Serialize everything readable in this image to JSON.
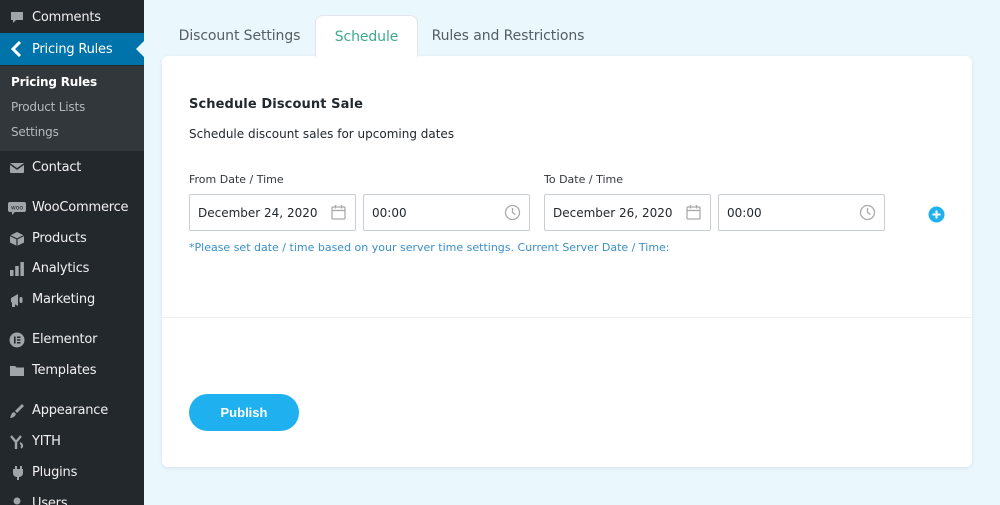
{
  "sidebar": {
    "items": [
      {
        "label": "Comments",
        "icon": "comments-icon"
      },
      {
        "label": "Pricing Rules",
        "icon": "chevron-left-icon",
        "active": true
      },
      {
        "label": "Contact",
        "icon": "envelope-icon"
      },
      {
        "label": "WooCommerce",
        "icon": "woocommerce-icon"
      },
      {
        "label": "Products",
        "icon": "box-icon"
      },
      {
        "label": "Analytics",
        "icon": "bar-chart-icon"
      },
      {
        "label": "Marketing",
        "icon": "megaphone-icon"
      },
      {
        "label": "Elementor",
        "icon": "elementor-icon"
      },
      {
        "label": "Templates",
        "icon": "folder-icon"
      },
      {
        "label": "Appearance",
        "icon": "paintbrush-icon"
      },
      {
        "label": "YITH",
        "icon": "yith-icon"
      },
      {
        "label": "Plugins",
        "icon": "plug-icon"
      },
      {
        "label": "Users",
        "icon": "user-icon"
      }
    ],
    "submenu": [
      {
        "label": "Pricing Rules",
        "current": true
      },
      {
        "label": "Product Lists"
      },
      {
        "label": "Settings"
      }
    ]
  },
  "tabs": [
    {
      "label": "Discount Settings"
    },
    {
      "label": "Schedule",
      "active": true
    },
    {
      "label": "Rules and Restrictions"
    }
  ],
  "schedule": {
    "title": "Schedule Discount Sale",
    "description": "Schedule discount sales for upcoming dates",
    "from_label": "From Date / Time",
    "to_label": "To Date / Time",
    "from_date": "December 24, 2020",
    "from_time": "00:00",
    "to_date": "December 26, 2020",
    "to_time": "00:00",
    "note": "*Please set date / time based on your server time settings. Current Server Date / Time:"
  },
  "publish_label": "Publish",
  "colors": {
    "sidebar_bg": "#23282d",
    "active_menu": "#0073aa",
    "accent": "#1fb0ef",
    "active_tab_text": "#3fa98c",
    "note_text": "#3a8fc7",
    "page_bg": "#eaf7fc"
  }
}
